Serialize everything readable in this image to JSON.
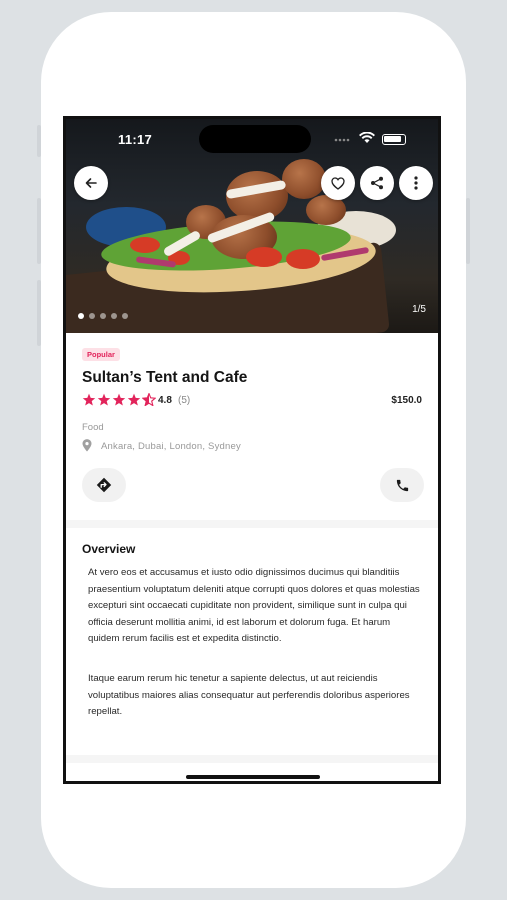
{
  "status": {
    "time": "11:17"
  },
  "hero": {
    "counter": "1/5",
    "dot_count": 5,
    "active_dot": 0
  },
  "place": {
    "badge": "Popular",
    "title": "Sultan’s Tent and Cafe",
    "rating": "4.8",
    "rating_count": "(5)",
    "stars_filled": 4.5,
    "price": "$150.0",
    "category": "Food",
    "locations": "Ankara, Dubai, London, Sydney"
  },
  "overview": {
    "title": "Overview",
    "paragraph1": "At vero eos et accusamus et iusto odio dignissimos ducimus qui blanditiis praesentium voluptatum deleniti atque corrupti quos dolores et quas molestias excepturi sint occaecati cupiditate non provident, similique sunt in culpa qui officia deserunt mollitia animi, id est laborum et dolorum fuga. Et harum quidem rerum facilis est et expedita distinctio.",
    "paragraph2": "Itaque earum rerum hic tenetur a sapiente delectus, ut aut reiciendis voluptatibus maiores alias consequatur aut perferendis doloribus asperiores repellat."
  },
  "colors": {
    "accent": "#e2245b",
    "badge_bg": "#fde0e6"
  },
  "icons": [
    "back-arrow-icon",
    "heart-icon",
    "share-icon",
    "more-vertical-icon",
    "location-pin-icon",
    "directions-icon",
    "phone-icon",
    "star-icon",
    "wifi-icon",
    "battery-icon",
    "signal-icon"
  ]
}
